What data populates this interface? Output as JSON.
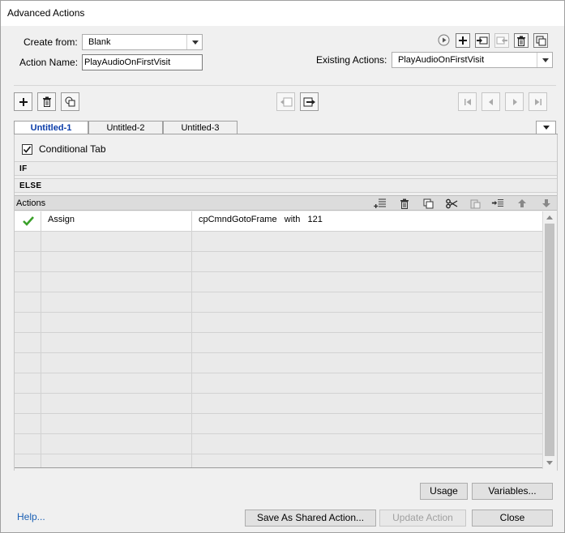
{
  "window": {
    "title": "Advanced Actions"
  },
  "form": {
    "create_from_label": "Create from:",
    "create_from_value": "Blank",
    "action_name_label": "Action Name:",
    "action_name_value": "PlayAudioOnFirstVisit",
    "existing_actions_label": "Existing Actions:",
    "existing_actions_value": "PlayAudioOnFirstVisit"
  },
  "top_icons": [
    "preview-icon",
    "new-action-icon",
    "import-icon",
    "export-icon",
    "delete-action-icon",
    "duplicate-action-icon"
  ],
  "toolbar_icons": [
    "add-tab-icon",
    "delete-tab-icon",
    "duplicate-tab-icon",
    "move-left-icon",
    "move-right-icon",
    "first-icon",
    "previous-icon",
    "next-icon",
    "last-icon"
  ],
  "tabs": [
    {
      "label": "Untitled-1",
      "active": true
    },
    {
      "label": "Untitled-2",
      "active": false
    },
    {
      "label": "Untitled-3",
      "active": false
    }
  ],
  "conditional": {
    "label": "Conditional Tab",
    "checked": true
  },
  "sections": {
    "if": "IF",
    "else": "ELSE"
  },
  "actions": {
    "header": "Actions",
    "header_icons": [
      "insert-icon",
      "delete-icon",
      "copy-icon",
      "cut-icon",
      "paste-icon",
      "insert-after-icon",
      "up-arrow-icon",
      "down-arrow-icon"
    ],
    "rows": [
      {
        "status": "check",
        "action": "Assign",
        "detail": "cpCmndGotoFrame   with   121"
      }
    ]
  },
  "buttons": {
    "usage": "Usage",
    "variables": "Variables...",
    "help": "Help...",
    "save_shared": "Save As Shared Action...",
    "update": "Update Action",
    "close": "Close"
  },
  "colors": {
    "active_tab": "#0a3ca8",
    "check": "#3aa02a",
    "link": "#1a5fb4"
  }
}
